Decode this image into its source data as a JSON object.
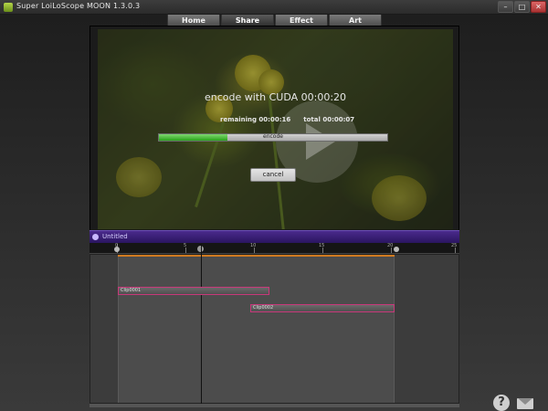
{
  "window": {
    "title": "Super LoiLoScope MOON 1.3.0.3",
    "controls": {
      "minimize": "–",
      "maximize": "□",
      "close": "✕"
    }
  },
  "tabs": [
    {
      "label": "Home",
      "active": false
    },
    {
      "label": "Share",
      "active": true
    },
    {
      "label": "Effect",
      "active": false
    },
    {
      "label": "Art",
      "active": false
    }
  ],
  "encode_dialog": {
    "title": "encode with CUDA  00:00:20",
    "remaining": "remaining 00:00:16",
    "total": "total 00:00:07",
    "progress_label": "encode",
    "progress_fraction": 0.3,
    "cancel_label": "cancel"
  },
  "timeline": {
    "project_title": "Untitled",
    "ruler_labels": [
      "0",
      "5",
      "10",
      "15",
      "20",
      "25"
    ],
    "clips": [
      {
        "label": "Clip0001"
      },
      {
        "label": "Clip0002"
      }
    ]
  },
  "icons": {
    "help": "?",
    "mail": "mail-icon"
  },
  "colors": {
    "timeline_header": "#3a1f78",
    "progress_fill": "#3fc42a",
    "clip_border": "#c8387a",
    "work_region_line": "#d07a20"
  }
}
